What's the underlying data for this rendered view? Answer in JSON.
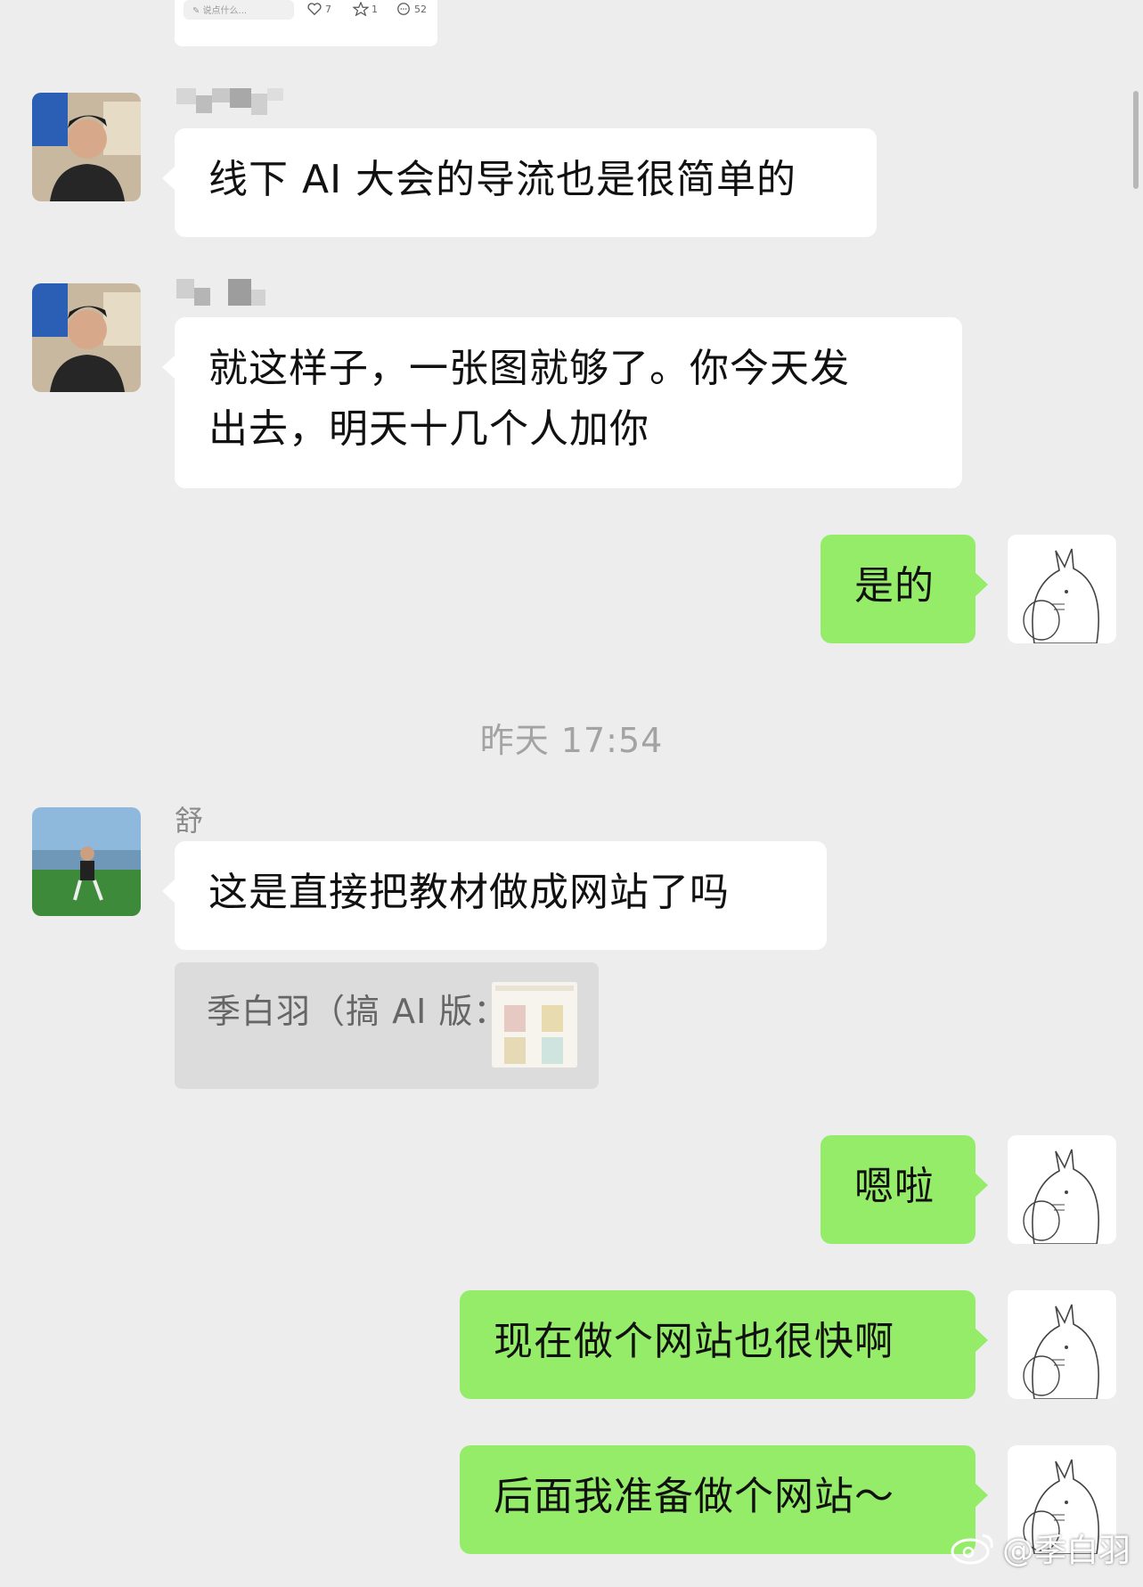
{
  "top_card": {
    "input_placeholder": "说点什么...",
    "likes": "7",
    "favorites": "1",
    "comments": "52"
  },
  "messages": [
    {
      "side": "in",
      "sender": "",
      "text": "线下 AI 大会的导流也是很简单的"
    },
    {
      "side": "in",
      "sender": "",
      "text_lines": [
        "就这样子，一张图就够了。你今天发",
        "出去，明天十几个人加你"
      ]
    },
    {
      "side": "out",
      "text": "是的"
    },
    {
      "side": "in",
      "sender": "舒",
      "text": "这是直接把教材做成网站了吗",
      "quote": "季白羽（搞 AI 版："
    },
    {
      "side": "out",
      "text": "嗯啦"
    },
    {
      "side": "out",
      "text": "现在做个网站也很快啊"
    },
    {
      "side": "out",
      "text": "后面我准备做个网站～"
    }
  ],
  "timestamp": "昨天 17:54",
  "watermark": "@季白羽",
  "colors": {
    "background": "#ededed",
    "outgoing_bubble": "#95ec69",
    "incoming_bubble": "#ffffff"
  }
}
